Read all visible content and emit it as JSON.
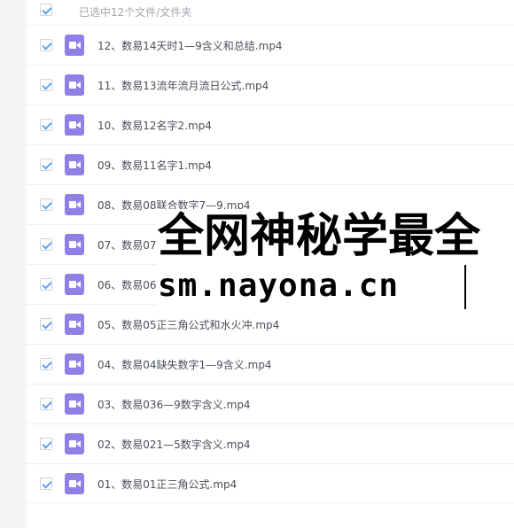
{
  "header": {
    "selection_label": "已选中12个文件/文件夹"
  },
  "files": [
    {
      "name": "12、数易14天时1—9含义和总结.mp4"
    },
    {
      "name": "11、数易13流年流月流日公式.mp4"
    },
    {
      "name": "10、数易12名字2.mp4"
    },
    {
      "name": "09、数易11名字1.mp4"
    },
    {
      "name": "08、数易08联合数字7—9.mp4"
    },
    {
      "name": "07、数易07"
    },
    {
      "name": "06、数易06"
    },
    {
      "name": "05、数易05正三角公式和水火冲.mp4"
    },
    {
      "name": "04、数易04缺失数字1—9含义.mp4"
    },
    {
      "name": "03、数易036—9数字含义.mp4"
    },
    {
      "name": "02、数易021—5数字含义.mp4"
    },
    {
      "name": "01、数易01正三角公式.mp4"
    }
  ],
  "icons": {
    "file": "video-file-icon",
    "check": "checkbox-checked-icon"
  },
  "colors": {
    "accent": "#5ba4f0",
    "video_icon": "#8f7fe6"
  },
  "watermark": {
    "line1": "全网神秘学最全",
    "line2": "sm.nayona.cn"
  }
}
